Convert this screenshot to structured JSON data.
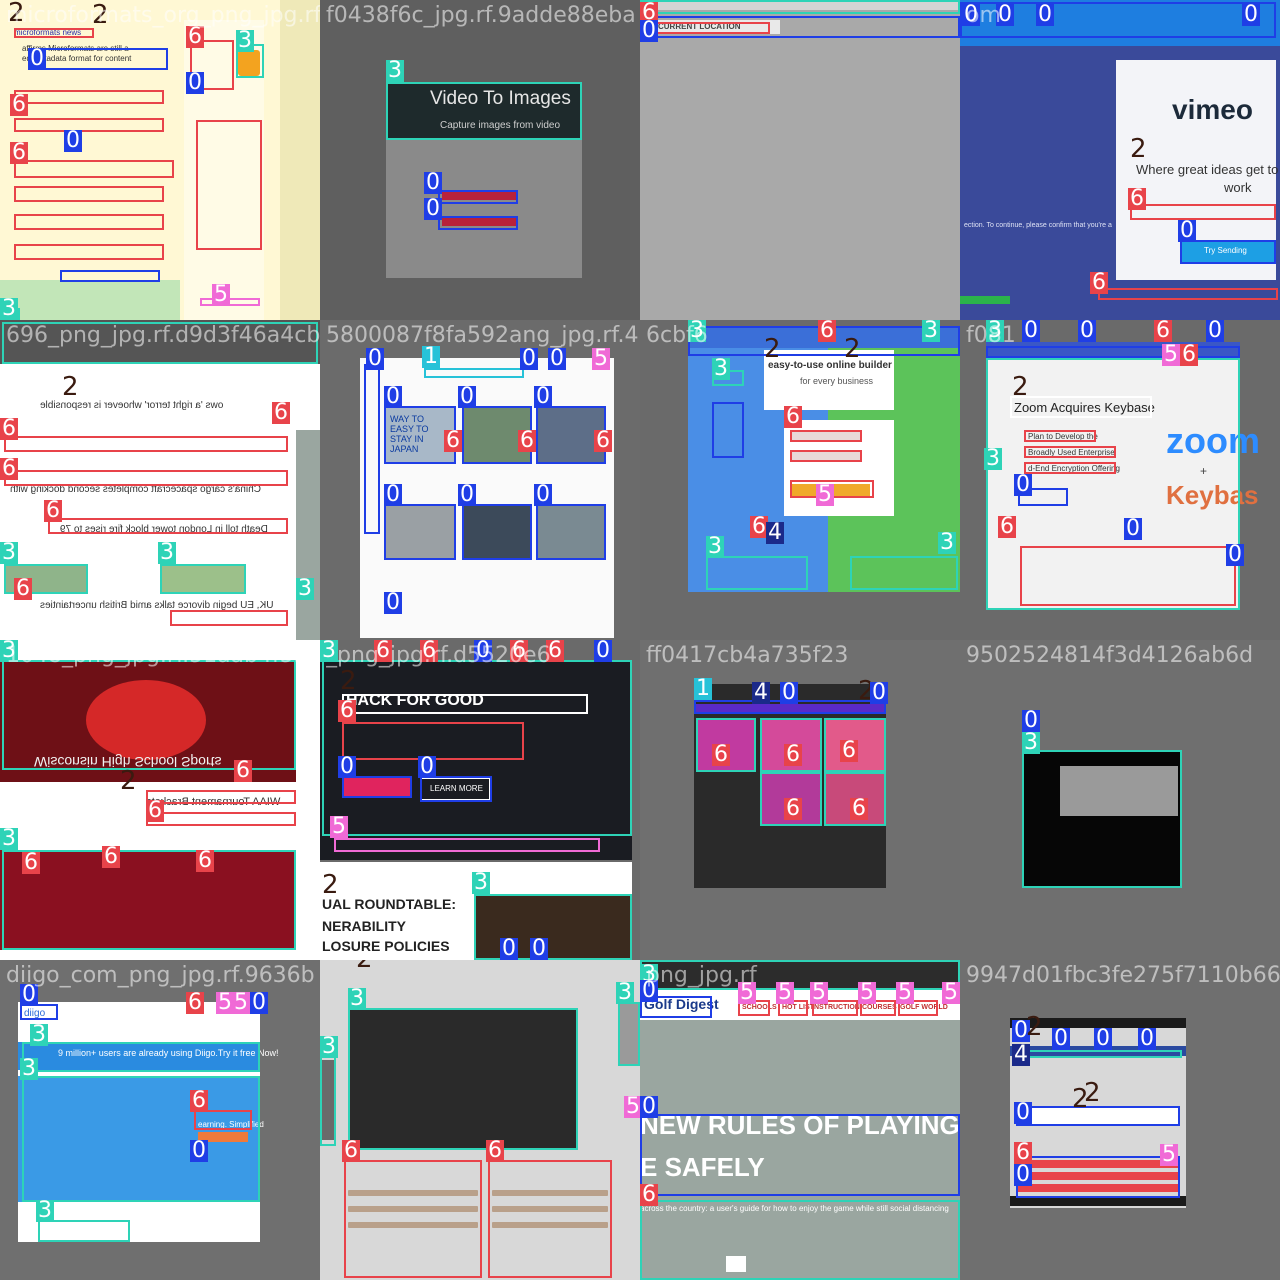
{
  "colors": {
    "class_0": "#1f3ee6",
    "class_1": "#27c2d8",
    "class_2": "#3a1b10",
    "class_3": "#2ed3b7",
    "class_4": "#1b2a8a",
    "class_5": "#f06ad6",
    "class_6": "#e8434a"
  },
  "tiles": [
    {
      "title": "microformats_org_png_jpg.rf",
      "texts": [
        "microformats news",
        "affirms Microformats are still a",
        "ed metadata format for content"
      ]
    },
    {
      "title": "f0438f6c_jpg.rf.9adde88eba",
      "texts": [
        "Video To Images",
        "Capture images from video"
      ]
    },
    {
      "title": "",
      "texts": [
        "CURRENT LOCATION"
      ]
    },
    {
      "title": "om",
      "texts": [
        "vimeo",
        "Where great ideas get to",
        "work",
        "Try Sending",
        "ection. To continue, please confirm that you're a"
      ]
    },
    {
      "title": "696_png_jpg.rf.d9d3f46a4cb",
      "texts": [
        "ows 'a right terror' whoever is responsible",
        "China's cargo spacecraft completes second docking with",
        "Death toll in London tower block fire rises to 79",
        "UK, EU begin divorce talks amid British uncertainties"
      ]
    },
    {
      "title": "5800087f8fa592ang_jpg.rf.46",
      "texts": [
        "WAY TO EASY TO STAY IN JAPAN"
      ]
    },
    {
      "title": "6cbf6",
      "texts": [
        "easy-to-use online builder",
        "for every business"
      ]
    },
    {
      "title": "f081",
      "texts": [
        "Zoom Acquires Keybase",
        "Plan to Develop the",
        "Broadly Used Enterprise",
        "d-End Encryption Offering",
        "zoom",
        "+",
        "Keybas"
      ]
    },
    {
      "title": "1048_png_jpg.rf.51aab4f53",
      "texts": [
        "Wisconsin High School Sports",
        "WIAA Tournament Brackets"
      ]
    },
    {
      "title": "_png_jpg.rf.d5520e6",
      "texts": [
        "HACK FOR GOOD",
        "LEARN MORE",
        "UAL ROUNDTABLE:",
        "NERABILITY",
        "LOSURE POLICIES"
      ]
    },
    {
      "title": "ff0417cb4a735f23",
      "texts": []
    },
    {
      "title": "9502524814f3d4126ab6d",
      "texts": []
    },
    {
      "title": "diigo_com_png_jpg.rf.9636b",
      "texts": [
        "diigo",
        "9 million+ users are already using Diigo.Try it free Now!",
        "earning. Simplified"
      ]
    },
    {
      "title": "",
      "texts": []
    },
    {
      "title": "png_jpg.rf",
      "texts": [
        "Golf Digest",
        "SCHOOLS",
        "HOT LIST",
        "INSTRUCTION",
        "COURSES",
        "GOLF WORLD",
        "NEW RULES OF PLAYING",
        "E SAFELY",
        "across the country: a user's guide for how to enjoy the game while still social distancing"
      ]
    },
    {
      "title": "9947d01fbc3fe275f7110b66",
      "texts": []
    }
  ],
  "labels": {
    "l0": "0",
    "l1": "1",
    "l2": "2",
    "l3": "3",
    "l4": "4",
    "l5": "5",
    "l6": "6"
  }
}
